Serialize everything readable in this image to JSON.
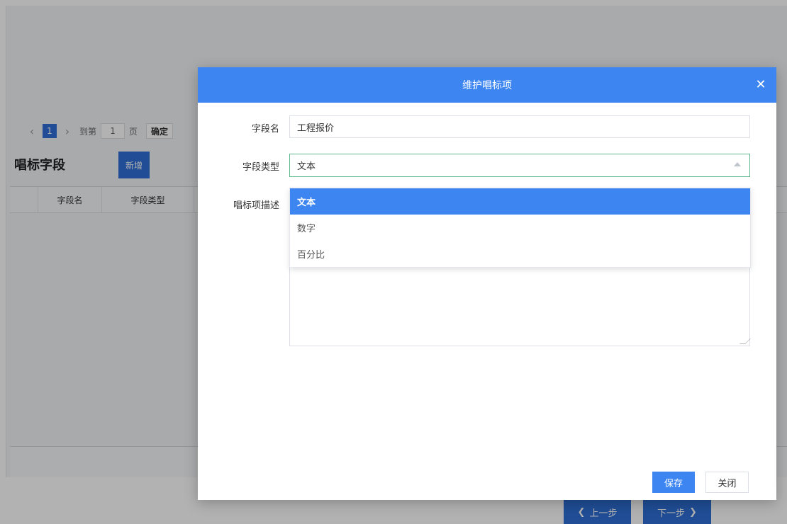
{
  "background": {
    "pager": {
      "prev_icon": "chevron-left-icon",
      "current_page": "1",
      "next_icon": "chevron-right-icon",
      "goto_label": "到第",
      "page_input_value": "1",
      "page_unit": "页",
      "confirm_label": "确定"
    },
    "section_title": "唱标字段",
    "add_button": "新增",
    "grid_columns": [
      "字段名",
      "字段类型"
    ],
    "prev_step": "上一步",
    "next_step": "下一步"
  },
  "dialog": {
    "title": "维护唱标项",
    "close_icon": "close-icon",
    "fields": {
      "name": {
        "label": "字段名",
        "value": "工程报价"
      },
      "type": {
        "label": "字段类型",
        "value": "文本"
      },
      "description": {
        "label": "唱标项描述",
        "value": ""
      }
    },
    "type_options": [
      {
        "label": "文本",
        "selected": true
      },
      {
        "label": "数字",
        "selected": false
      },
      {
        "label": "百分比",
        "selected": false
      }
    ],
    "save_label": "保存",
    "close_label": "关闭"
  },
  "colors": {
    "primary": "#3d86f2",
    "select_border": "#5dbb8d"
  }
}
